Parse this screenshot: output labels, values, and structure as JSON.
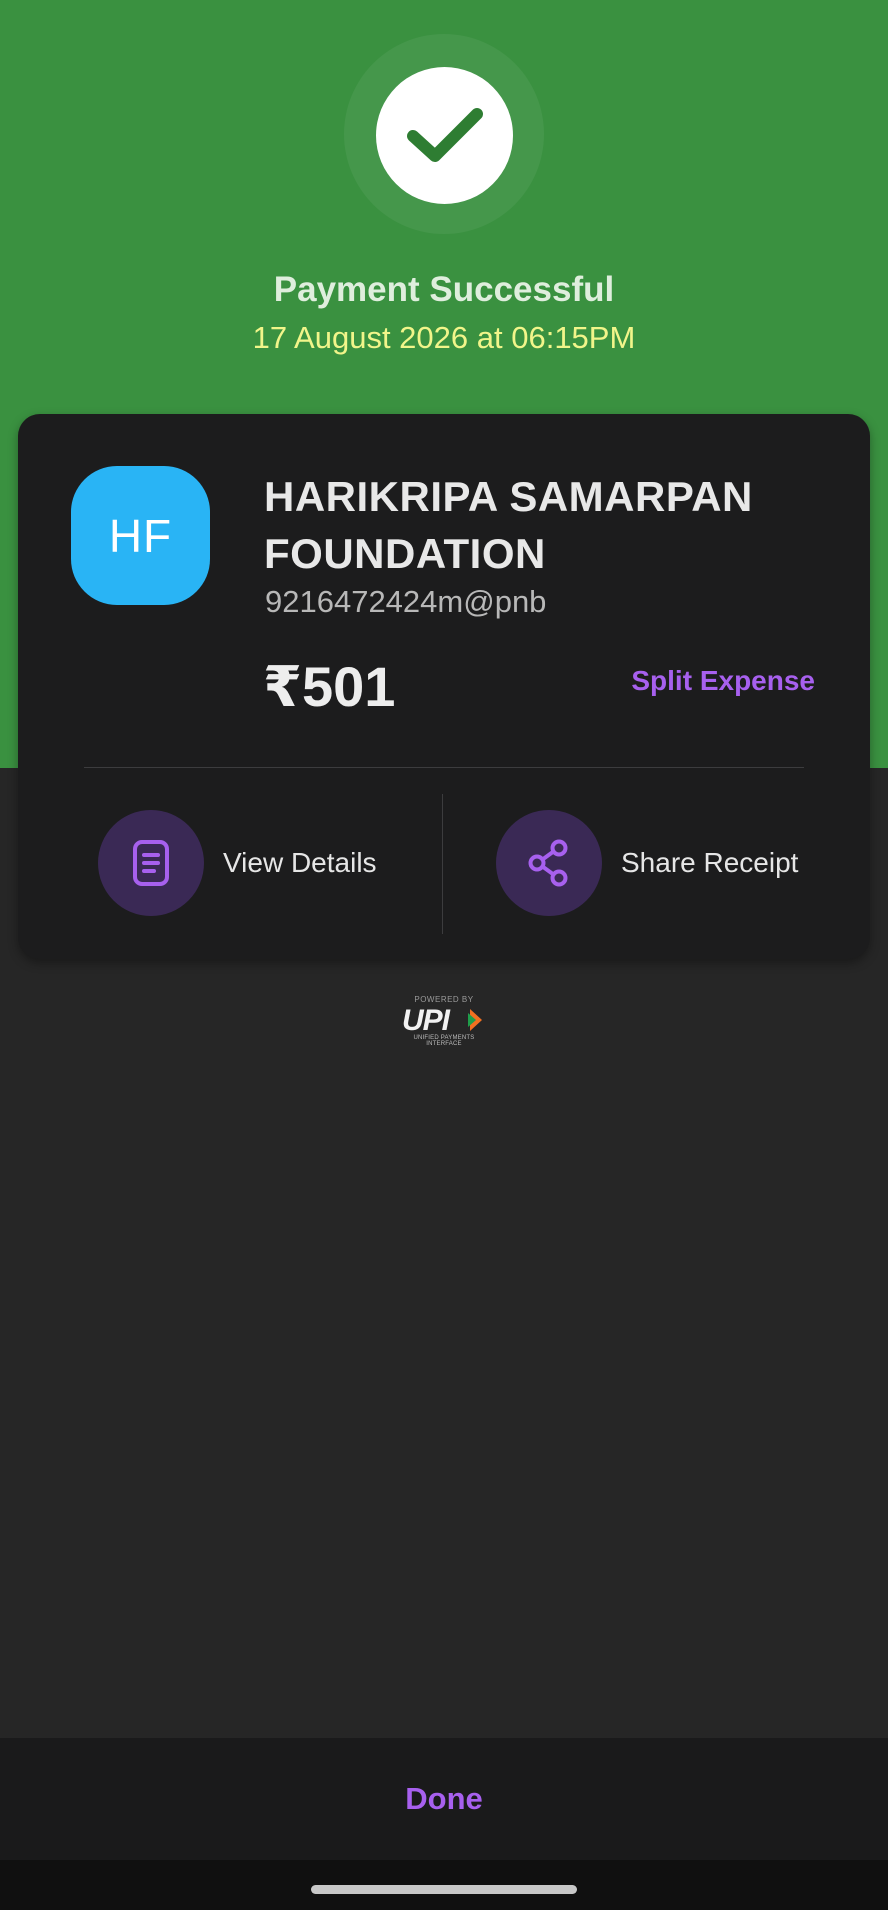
{
  "header": {
    "status_title": "Payment Successful",
    "timestamp": "17 August 2026 at 06:15PM",
    "icon": "check-icon"
  },
  "payee": {
    "initials": "HF",
    "name": "HARIKRIPA SAMARPAN FOUNDATION",
    "upi_id": "9216472424m@pnb",
    "avatar_color": "#29b4f5"
  },
  "payment": {
    "amount": "₹501",
    "split_label": "Split Expense"
  },
  "actions": [
    {
      "label": "View Details",
      "icon": "document-icon"
    },
    {
      "label": "Share Receipt",
      "icon": "share-icon"
    }
  ],
  "footer_logo": {
    "powered_by": "POWERED BY",
    "mark": "UPI",
    "subtitle": "UNIFIED PAYMENTS INTERFACE"
  },
  "bottom": {
    "done_label": "Done"
  },
  "colors": {
    "success_green": "#3a9140",
    "accent_purple": "#a760ee",
    "timestamp_yellow": "#f1f58a"
  }
}
